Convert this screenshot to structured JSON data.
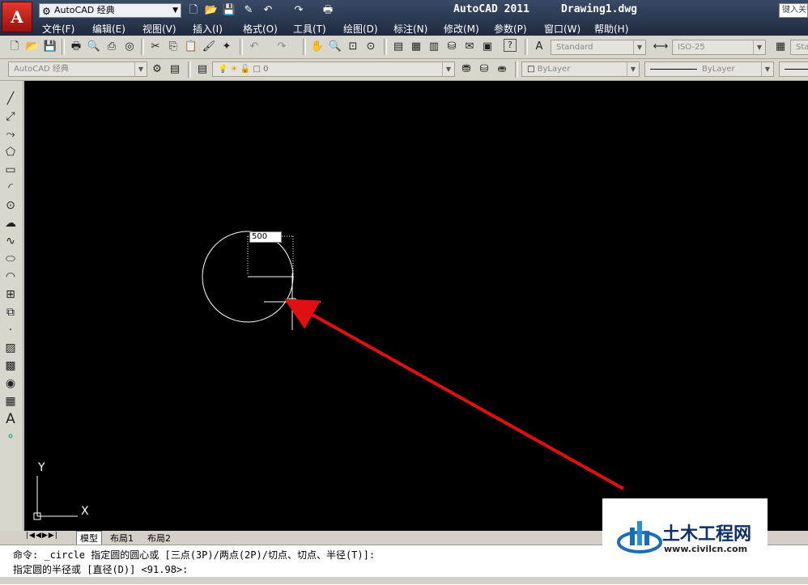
{
  "titlebar": {
    "app_letter": "A",
    "workspace": "AutoCAD 经典",
    "title": "AutoCAD 2011     Drawing1.dwg",
    "search_placeholder": "键入关键字或短语"
  },
  "menu": [
    "文件(F)",
    "编辑(E)",
    "视图(V)",
    "插入(I)",
    "格式(O)",
    "工具(T)",
    "绘图(D)",
    "标注(N)",
    "修改(M)",
    "参数(P)",
    "窗口(W)",
    "帮助(H)"
  ],
  "styles_toolbar": {
    "text_style": "Standard",
    "dim_style": "ISO-25",
    "table_style": "Standard"
  },
  "layers_toolbar": {
    "workspace": "AutoCAD 经典",
    "current_layer": "0",
    "color": "ByLayer",
    "linetype": "ByLayer"
  },
  "canvas": {
    "radius_input": "500",
    "ucs_y": "Y",
    "ucs_x": "X",
    "accent_arrow_color": "#e01010"
  },
  "layout_tabs": [
    "模型",
    "布局1",
    "布局2"
  ],
  "command_line": {
    "line1": "命令: _circle 指定圆的圆心或 [三点(3P)/两点(2P)/切点、切点、半径(T)]:",
    "line2": "指定圆的半径或 [直径(D)] <91.98>:"
  },
  "watermark": {
    "name": "土木工程网",
    "url": "www.civilcn.com"
  }
}
